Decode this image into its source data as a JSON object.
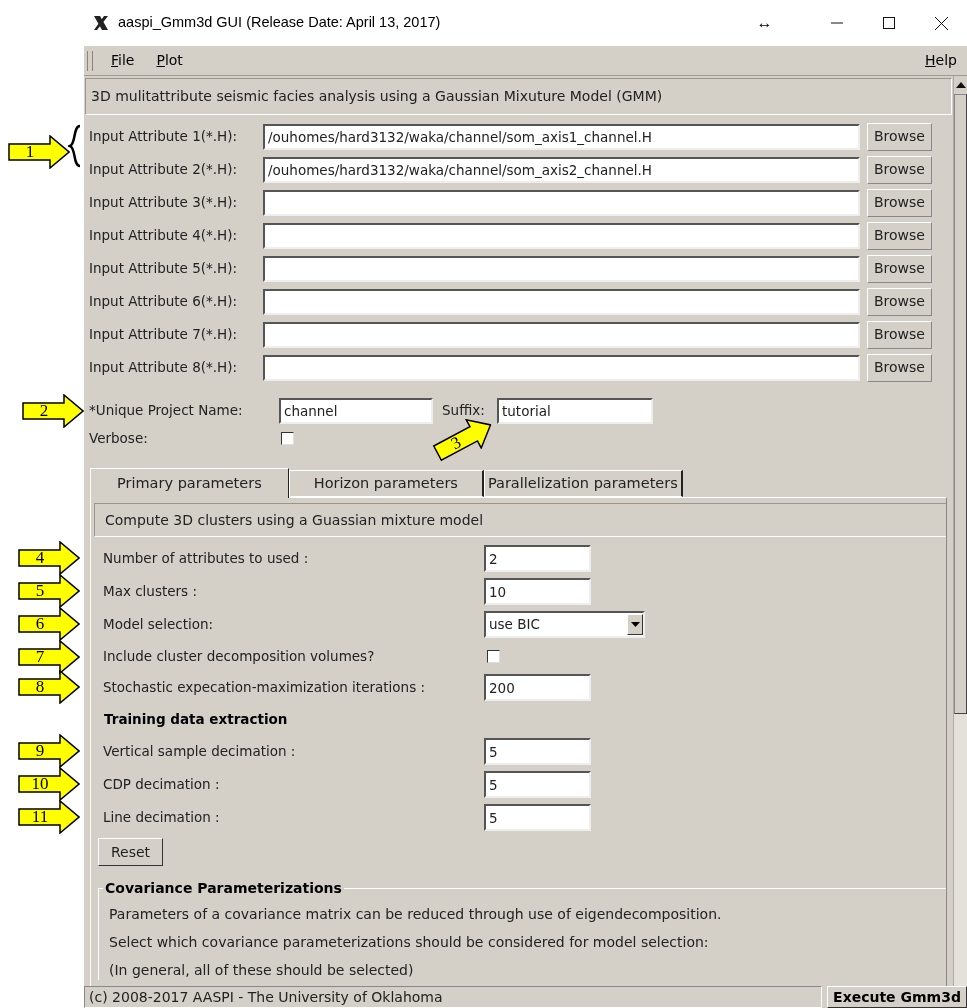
{
  "window": {
    "title": "aaspi_Gmm3d GUI (Release Date: April 13, 2017)",
    "resize_glyph": "↔"
  },
  "menu": {
    "items": [
      "File",
      "Plot"
    ],
    "help": "Help"
  },
  "description": "3D mulitattribute seismic facies analysis using a Gaussian Mixuture Model (GMM)",
  "inputs": [
    {
      "label": "Input Attribute 1(*.H):",
      "value": "/ouhomes/hard3132/waka/channel/som_axis1_channel.H",
      "button": "Browse",
      "callout": "1"
    },
    {
      "label": "Input Attribute 2(*.H):",
      "value": "/ouhomes/hard3132/waka/channel/som_axis2_channel.H",
      "button": "Browse"
    },
    {
      "label": "Input Attribute 3(*.H):",
      "button": "Browse"
    },
    {
      "label": "Input Attribute 4(*.H):",
      "button": "Browse"
    },
    {
      "label": "Input Attribute 5(*.H):",
      "button": "Browse"
    },
    {
      "label": "Input Attribute 6(*.H):",
      "button": "Browse"
    },
    {
      "label": "Input Attribute 7(*.H):",
      "button": "Browse"
    },
    {
      "label": "Input Attribute 8(*.H):",
      "button": "Browse"
    }
  ],
  "project": {
    "label": "*Unique Project Name:",
    "value": "channel",
    "callout": "2",
    "suffix_label": "Suffix:",
    "suffix_value": "tutorial",
    "suffix_callout": "3"
  },
  "verbose": {
    "label": "Verbose:",
    "checked": false
  },
  "tabs": [
    {
      "label": "Primary parameters",
      "selected": true
    },
    {
      "label": "Horizon parameters",
      "selected": false
    },
    {
      "label": "Parallelization parameters",
      "selected": false
    }
  ],
  "panel": {
    "description": "Compute 3D clusters using a Guassian mixture model",
    "rows": [
      {
        "kind": "field",
        "label": "Number of attributes to used :",
        "value": "2",
        "callout": "4"
      },
      {
        "kind": "field",
        "label": "Max clusters :",
        "value": "10",
        "callout": "5"
      },
      {
        "kind": "select",
        "label": "Model selection:",
        "value": "use BIC",
        "callout": "6"
      },
      {
        "kind": "checkbox",
        "label": "Include cluster decomposition volumes?",
        "checked": false,
        "callout": "7"
      },
      {
        "kind": "field",
        "label": "Stochastic expecation-maximization iterations :",
        "value": "200",
        "callout": "8"
      },
      {
        "kind": "heading",
        "label": "Training data extraction"
      },
      {
        "kind": "field",
        "label": "Vertical sample decimation :",
        "value": "5",
        "callout": "9"
      },
      {
        "kind": "field",
        "label": "CDP decimation :",
        "value": "5",
        "callout": "10"
      },
      {
        "kind": "field",
        "label": "Line decimation :",
        "value": "5",
        "callout": "11"
      }
    ],
    "reset": "Reset",
    "group": {
      "title": "Covariance Parameterizations",
      "lines": [
        "Parameters of a covariance matrix can be reduced through use of eigendecomposition.",
        "Select which covariance parameterizations should be considered for model selection:",
        "(In general, all of these should be selected)"
      ]
    }
  },
  "status_bar": {
    "text": "(c) 2008-2017 AASPI - The University of Oklahoma",
    "button": "Execute Gmm3d"
  }
}
